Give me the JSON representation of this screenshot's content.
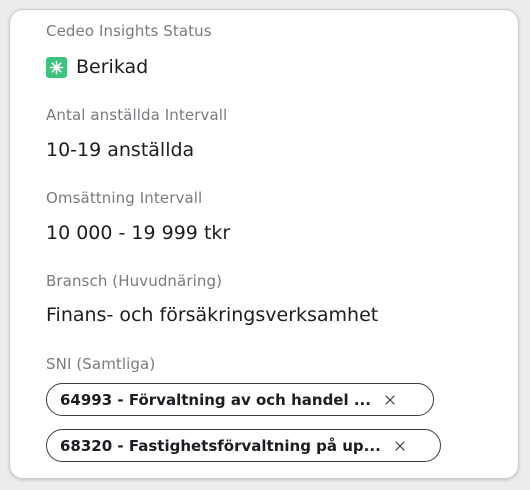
{
  "status": {
    "label": "Cedeo Insights Status",
    "value": "Berikad",
    "icon": "sparkle-icon",
    "icon_color": "#3ac47d"
  },
  "employees": {
    "label": "Antal anställda Intervall",
    "value": "10-19 anställda"
  },
  "turnover": {
    "label": "Omsättning Intervall",
    "value": "10 000 - 19 999 tkr"
  },
  "industry": {
    "label": "Bransch (Huvudnäring)",
    "value": "Finans- och försäkringsverksamhet"
  },
  "sni": {
    "label": "SNI (Samtliga)",
    "chips": [
      {
        "text": "64993 - Förvaltning av och handel ...",
        "close_icon": "close-icon"
      },
      {
        "text": "68320 - Fastighetsförvaltning på up...",
        "close_icon": "close-icon"
      }
    ]
  }
}
